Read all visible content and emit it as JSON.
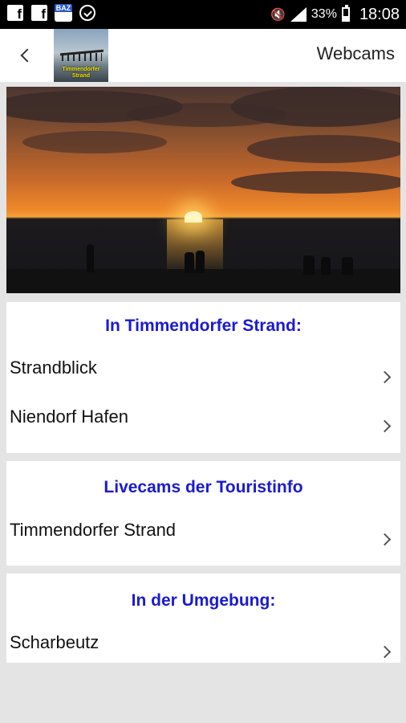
{
  "status_bar": {
    "battery": "33%",
    "time": "18:08",
    "icons": [
      "facebook-icon",
      "facebook-icon",
      "baz-app-icon",
      "sync-icon",
      "mute-icon",
      "signal-icon",
      "battery-icon"
    ]
  },
  "app_bar": {
    "title": "Webcams",
    "logo_text": "Timmendorfer Strand",
    "back_icon": "back-chevron-icon"
  },
  "sections": [
    {
      "heading": "In Timmendorfer Strand:",
      "items": [
        "Strandblick",
        "Niendorf Hafen"
      ]
    },
    {
      "heading": "Livecams der Touristinfo",
      "items": [
        "Timmendorfer Strand"
      ]
    },
    {
      "heading": "In der Umgebung:",
      "items": [
        "Scharbeutz"
      ]
    }
  ],
  "colors": {
    "heading": "#1a1ad4",
    "background": "#e4e4e4",
    "status_bar": "#000000"
  }
}
